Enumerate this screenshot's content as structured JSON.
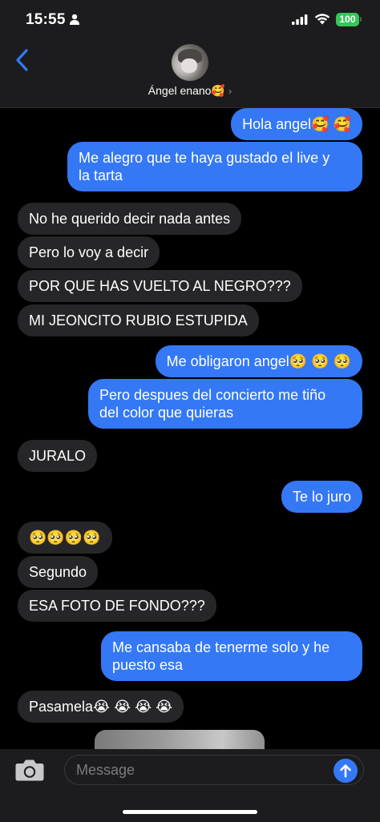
{
  "status_bar": {
    "time": "15:55",
    "battery": "100",
    "colors": {
      "battery": "#34c759"
    }
  },
  "header": {
    "contact_name": "Ángel enano🥰",
    "chevron": "›",
    "icons": {
      "back": "chevron-left-icon",
      "avatar": "contact-avatar"
    }
  },
  "colors": {
    "outgoing_bubble": "#3478f6",
    "incoming_bubble": "#262628",
    "background": "#000000"
  },
  "messages": [
    {
      "direction": "out",
      "text": "Hola angel🥰 🥰"
    },
    {
      "direction": "out",
      "text": "Me alegro que te haya gustado el live y\nla tarta"
    },
    {
      "direction": "in",
      "text": "No he querido decir nada antes"
    },
    {
      "direction": "in",
      "text": "Pero lo voy a decir"
    },
    {
      "direction": "in",
      "text": "POR QUE HAS VUELTO AL NEGRO???"
    },
    {
      "direction": "in",
      "text": "MI JEONCITO RUBIO ESTUPIDA"
    },
    {
      "direction": "out",
      "text": "Me obligaron angel🥺 🥺 🥺"
    },
    {
      "direction": "out",
      "text": "Pero despues del concierto me tiño\ndel color que quieras"
    },
    {
      "direction": "in",
      "text": "JURALO"
    },
    {
      "direction": "out",
      "text": "Te lo juro"
    },
    {
      "direction": "in",
      "text": "🥺🥺🥺🥺"
    },
    {
      "direction": "in",
      "text": "Segundo"
    },
    {
      "direction": "in",
      "text": "ESA FOTO DE FONDO???"
    },
    {
      "direction": "out",
      "text": "Me cansaba de tenerme solo y he\npuesto esa"
    },
    {
      "direction": "in",
      "text": "Pasamela😭 😭 😭 😭"
    }
  ],
  "input": {
    "placeholder": "Message",
    "value": "",
    "icons": {
      "camera": "camera-icon",
      "send": "send-arrow-icon"
    }
  }
}
